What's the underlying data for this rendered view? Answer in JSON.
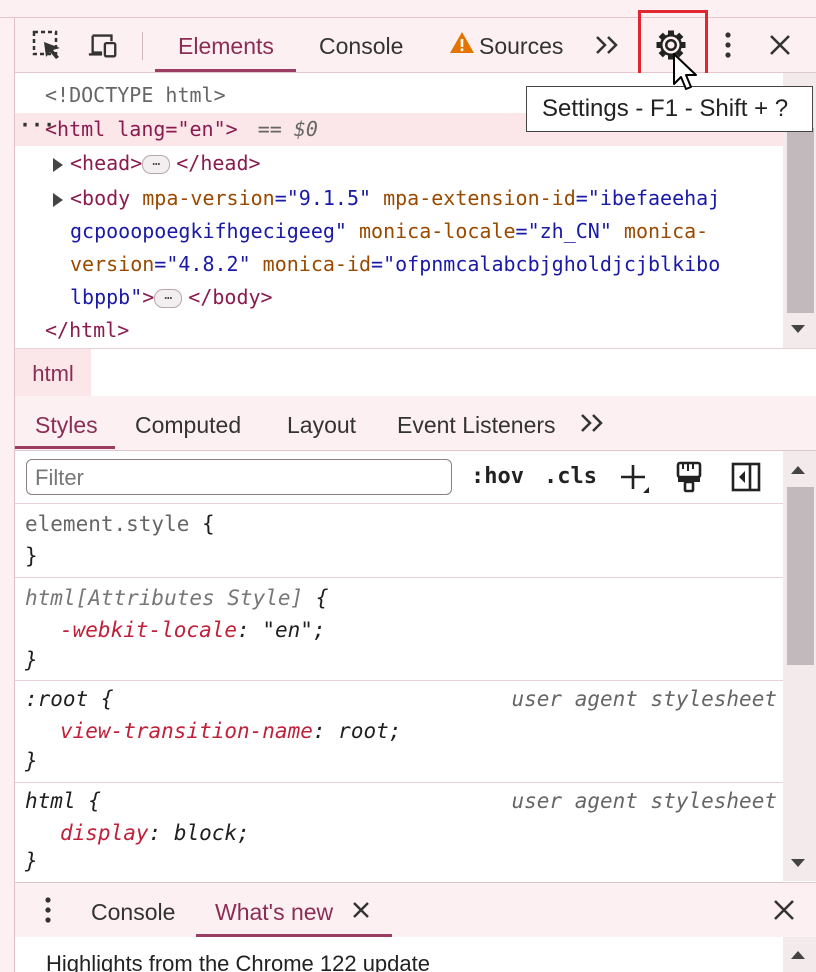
{
  "toolbar": {
    "tabs": [
      {
        "label": "Elements"
      },
      {
        "label": "Console"
      },
      {
        "label": "Sources"
      }
    ],
    "more_tabs": "»",
    "tooltip": "Settings - F1 - Shift + ?"
  },
  "dom_tree": {
    "doctype": "<!DOCTYPE html>",
    "html_open": "<html lang=\"en\">",
    "html_selected_suffix": "== $0",
    "head": "<head>",
    "head_close": "</head>",
    "body_tag": "<body",
    "body_attrs": [
      {
        "name": "mpa-version",
        "value": "\"9.1.5\""
      },
      {
        "name": "mpa-extension-id",
        "value": "\"ibefaeehajgcpooopoegkifhgecigeeg\""
      },
      {
        "name": "monica-locale",
        "value": "\"zh_CN\""
      },
      {
        "name": "monica-version",
        "value": "\"4.8.2\""
      },
      {
        "name": "monica-id",
        "value": "\"ofpnmcalabcbjgholdjcjblkibolbppb\""
      }
    ],
    "line1_prefix": "<body ",
    "line1_a": "mpa-version",
    "line1_av": "=\"9.1.5\"",
    "line1_b": "mpa-extension-id",
    "line1_bv": "=\"ibefaeehaj",
    "line2_bv": "gcpooopoegkifhgecigeeg\"",
    "line2_c": "monica-locale",
    "line2_cv": "=\"zh_CN\"",
    "line2_d": "monica-",
    "line3_d": "version",
    "line3_dv": "=\"4.8.2\"",
    "line3_e": "monica-id",
    "line3_ev": "=\"ofpnmcalabcbjgholdjcjblkibo",
    "line4_ev": "lbppb\"",
    "line4_close": ">",
    "body_close": "</body>",
    "html_close": "</html>",
    "ellipsis": "…"
  },
  "breadcrumb": {
    "label": "html"
  },
  "styles_tabs": [
    {
      "label": "Styles"
    },
    {
      "label": "Computed"
    },
    {
      "label": "Layout"
    },
    {
      "label": "Event Listeners"
    }
  ],
  "styles_toolbar": {
    "filter_placeholder": "Filter",
    "hov": ":hov",
    "cls": ".cls"
  },
  "rules": [
    {
      "selector": "element.style",
      "open": " {",
      "close": "}"
    },
    {
      "selector": "html[Attributes Style]",
      "open": " {",
      "property": "-webkit-locale",
      "value": "\"en\"",
      "close": "}"
    },
    {
      "selector": ":root",
      "open": " {",
      "source": "user agent stylesheet",
      "property": "view-transition-name",
      "value": "root",
      "close": "}"
    },
    {
      "selector": "html",
      "open": " {",
      "source": "user agent stylesheet",
      "property": "display",
      "value": "block",
      "close": "}"
    }
  ],
  "drawer": {
    "tabs": [
      {
        "label": "Console"
      },
      {
        "label": "What's new"
      }
    ],
    "content": "Highlights from the Chrome 122 update"
  },
  "colors": {
    "accent": "#8b2d55",
    "highlight_box": "#e0262e",
    "toolbar_bg": "#fdf0f2"
  }
}
